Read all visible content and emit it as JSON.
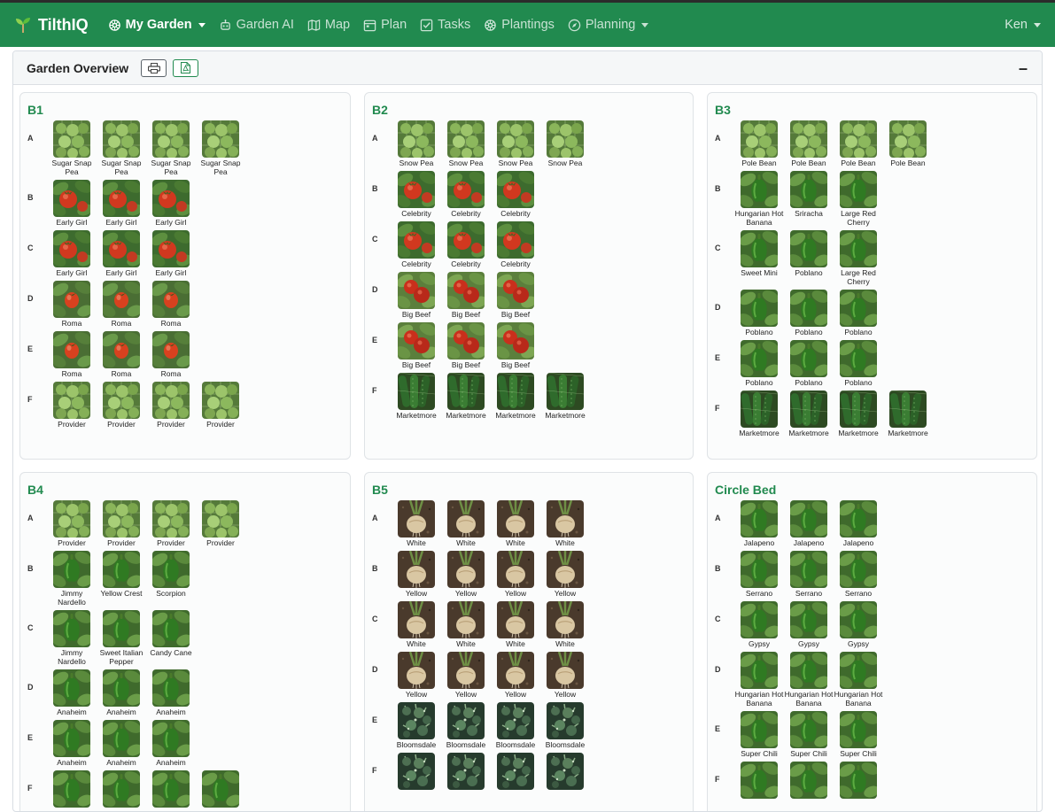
{
  "app": {
    "name": "TilthIQ"
  },
  "nav": {
    "items": [
      {
        "label": "My Garden",
        "icon": "flower-icon",
        "active": true,
        "dropdown": true
      },
      {
        "label": "Garden AI",
        "icon": "robot-icon",
        "active": false,
        "dropdown": false
      },
      {
        "label": "Map",
        "icon": "map-icon",
        "active": false,
        "dropdown": false
      },
      {
        "label": "Plan",
        "icon": "calendar-icon",
        "active": false,
        "dropdown": false
      },
      {
        "label": "Tasks",
        "icon": "checkbox-icon",
        "active": false,
        "dropdown": false
      },
      {
        "label": "Plantings",
        "icon": "flower-icon",
        "active": false,
        "dropdown": false
      },
      {
        "label": "Planning",
        "icon": "compass-icon",
        "active": false,
        "dropdown": true
      }
    ],
    "user": "Ken"
  },
  "overview": {
    "title": "Garden Overview",
    "collapse_label": "–"
  },
  "colors": {
    "brand": "#218a4f",
    "accent": "#218a4f"
  },
  "beds": [
    {
      "name": "B1",
      "rows": [
        {
          "label": "A",
          "plants": [
            {
              "name": "Sugar Snap Pea",
              "type": "pea"
            },
            {
              "name": "Sugar Snap Pea",
              "type": "pea"
            },
            {
              "name": "Sugar Snap Pea",
              "type": "pea"
            },
            {
              "name": "Sugar Snap Pea",
              "type": "pea"
            }
          ]
        },
        {
          "label": "B",
          "plants": [
            {
              "name": "Early Girl",
              "type": "tomato"
            },
            {
              "name": "Early Girl",
              "type": "tomato"
            },
            {
              "name": "Early Girl",
              "type": "tomato"
            }
          ]
        },
        {
          "label": "C",
          "plants": [
            {
              "name": "Early Girl",
              "type": "tomato"
            },
            {
              "name": "Early Girl",
              "type": "tomato"
            },
            {
              "name": "Early Girl",
              "type": "tomato"
            }
          ]
        },
        {
          "label": "D",
          "plants": [
            {
              "name": "Roma",
              "type": "roma"
            },
            {
              "name": "Roma",
              "type": "roma"
            },
            {
              "name": "Roma",
              "type": "roma"
            }
          ]
        },
        {
          "label": "E",
          "plants": [
            {
              "name": "Roma",
              "type": "roma"
            },
            {
              "name": "Roma",
              "type": "roma"
            },
            {
              "name": "Roma",
              "type": "roma"
            }
          ]
        },
        {
          "label": "F",
          "plants": [
            {
              "name": "Provider",
              "type": "pea"
            },
            {
              "name": "Provider",
              "type": "pea"
            },
            {
              "name": "Provider",
              "type": "pea"
            },
            {
              "name": "Provider",
              "type": "pea"
            }
          ]
        }
      ]
    },
    {
      "name": "B2",
      "rows": [
        {
          "label": "A",
          "plants": [
            {
              "name": "Snow Pea",
              "type": "pea"
            },
            {
              "name": "Snow Pea",
              "type": "pea"
            },
            {
              "name": "Snow Pea",
              "type": "pea"
            },
            {
              "name": "Snow Pea",
              "type": "pea"
            }
          ]
        },
        {
          "label": "B",
          "plants": [
            {
              "name": "Celebrity",
              "type": "tomato"
            },
            {
              "name": "Celebrity",
              "type": "tomato"
            },
            {
              "name": "Celebrity",
              "type": "tomato"
            }
          ]
        },
        {
          "label": "C",
          "plants": [
            {
              "name": "Celebrity",
              "type": "tomato"
            },
            {
              "name": "Celebrity",
              "type": "tomato"
            },
            {
              "name": "Celebrity",
              "type": "tomato"
            }
          ]
        },
        {
          "label": "D",
          "plants": [
            {
              "name": "Big Beef",
              "type": "bigbeef"
            },
            {
              "name": "Big Beef",
              "type": "bigbeef"
            },
            {
              "name": "Big Beef",
              "type": "bigbeef"
            }
          ]
        },
        {
          "label": "E",
          "plants": [
            {
              "name": "Big Beef",
              "type": "bigbeef"
            },
            {
              "name": "Big Beef",
              "type": "bigbeef"
            },
            {
              "name": "Big Beef",
              "type": "bigbeef"
            }
          ]
        },
        {
          "label": "F",
          "plants": [
            {
              "name": "Marketmore",
              "type": "cucumber"
            },
            {
              "name": "Marketmore",
              "type": "cucumber"
            },
            {
              "name": "Marketmore",
              "type": "cucumber"
            },
            {
              "name": "Marketmore",
              "type": "cucumber"
            }
          ]
        }
      ]
    },
    {
      "name": "B3",
      "rows": [
        {
          "label": "A",
          "plants": [
            {
              "name": "Pole Bean",
              "type": "pea"
            },
            {
              "name": "Pole Bean",
              "type": "pea"
            },
            {
              "name": "Pole Bean",
              "type": "pea"
            },
            {
              "name": "Pole Bean",
              "type": "pea"
            }
          ]
        },
        {
          "label": "B",
          "plants": [
            {
              "name": "Hungarian Hot Banana",
              "type": "pepper"
            },
            {
              "name": "Sriracha",
              "type": "pepper"
            },
            {
              "name": "Large Red Cherry",
              "type": "pepper"
            }
          ]
        },
        {
          "label": "C",
          "plants": [
            {
              "name": "Sweet Mini",
              "type": "pepper"
            },
            {
              "name": "Poblano",
              "type": "pepper"
            },
            {
              "name": "Large Red Cherry",
              "type": "pepper"
            }
          ]
        },
        {
          "label": "D",
          "plants": [
            {
              "name": "Poblano",
              "type": "pepper"
            },
            {
              "name": "Poblano",
              "type": "pepper"
            },
            {
              "name": "Poblano",
              "type": "pepper"
            }
          ]
        },
        {
          "label": "E",
          "plants": [
            {
              "name": "Poblano",
              "type": "pepper"
            },
            {
              "name": "Poblano",
              "type": "pepper"
            },
            {
              "name": "Poblano",
              "type": "pepper"
            }
          ]
        },
        {
          "label": "F",
          "plants": [
            {
              "name": "Marketmore",
              "type": "cucumber"
            },
            {
              "name": "Marketmore",
              "type": "cucumber"
            },
            {
              "name": "Marketmore",
              "type": "cucumber"
            },
            {
              "name": "Marketmore",
              "type": "cucumber"
            }
          ]
        }
      ]
    },
    {
      "name": "B4",
      "rows": [
        {
          "label": "A",
          "plants": [
            {
              "name": "Provider",
              "type": "pea"
            },
            {
              "name": "Provider",
              "type": "pea"
            },
            {
              "name": "Provider",
              "type": "pea"
            },
            {
              "name": "Provider",
              "type": "pea"
            }
          ]
        },
        {
          "label": "B",
          "plants": [
            {
              "name": "Jimmy Nardello",
              "type": "pepper"
            },
            {
              "name": "Yellow Crest",
              "type": "pepper"
            },
            {
              "name": "Scorpion",
              "type": "pepper"
            }
          ]
        },
        {
          "label": "C",
          "plants": [
            {
              "name": "Jimmy Nardello",
              "type": "pepper"
            },
            {
              "name": "Sweet Italian Pepper",
              "type": "pepper"
            },
            {
              "name": "Candy Cane",
              "type": "pepper"
            }
          ]
        },
        {
          "label": "D",
          "plants": [
            {
              "name": "Anaheim",
              "type": "pepper"
            },
            {
              "name": "Anaheim",
              "type": "pepper"
            },
            {
              "name": "Anaheim",
              "type": "pepper"
            }
          ]
        },
        {
          "label": "E",
          "plants": [
            {
              "name": "Anaheim",
              "type": "pepper"
            },
            {
              "name": "Anaheim",
              "type": "pepper"
            },
            {
              "name": "Anaheim",
              "type": "pepper"
            }
          ]
        },
        {
          "label": "F",
          "plants": [
            {
              "name": "",
              "type": "pepper"
            },
            {
              "name": "",
              "type": "pepper"
            },
            {
              "name": "",
              "type": "pepper"
            },
            {
              "name": "",
              "type": "pepper"
            }
          ]
        }
      ]
    },
    {
      "name": "B5",
      "rows": [
        {
          "label": "A",
          "plants": [
            {
              "name": "White",
              "type": "onion"
            },
            {
              "name": "White",
              "type": "onion"
            },
            {
              "name": "White",
              "type": "onion"
            },
            {
              "name": "White",
              "type": "onion"
            }
          ]
        },
        {
          "label": "B",
          "plants": [
            {
              "name": "Yellow",
              "type": "onion"
            },
            {
              "name": "Yellow",
              "type": "onion"
            },
            {
              "name": "Yellow",
              "type": "onion"
            },
            {
              "name": "Yellow",
              "type": "onion"
            }
          ]
        },
        {
          "label": "C",
          "plants": [
            {
              "name": "White",
              "type": "onion"
            },
            {
              "name": "White",
              "type": "onion"
            },
            {
              "name": "White",
              "type": "onion"
            },
            {
              "name": "White",
              "type": "onion"
            }
          ]
        },
        {
          "label": "D",
          "plants": [
            {
              "name": "Yellow",
              "type": "onion"
            },
            {
              "name": "Yellow",
              "type": "onion"
            },
            {
              "name": "Yellow",
              "type": "onion"
            },
            {
              "name": "Yellow",
              "type": "onion"
            }
          ]
        },
        {
          "label": "E",
          "plants": [
            {
              "name": "Bloomsdale",
              "type": "spinach"
            },
            {
              "name": "Bloomsdale",
              "type": "spinach"
            },
            {
              "name": "Bloomsdale",
              "type": "spinach"
            },
            {
              "name": "Bloomsdale",
              "type": "spinach"
            }
          ]
        },
        {
          "label": "F",
          "plants": [
            {
              "name": "",
              "type": "spinach"
            },
            {
              "name": "",
              "type": "spinach"
            },
            {
              "name": "",
              "type": "spinach"
            },
            {
              "name": "",
              "type": "spinach"
            }
          ]
        }
      ]
    },
    {
      "name": "Circle Bed",
      "rows": [
        {
          "label": "A",
          "plants": [
            {
              "name": "Jalapeno",
              "type": "pepper"
            },
            {
              "name": "Jalapeno",
              "type": "pepper"
            },
            {
              "name": "Jalapeno",
              "type": "pepper"
            }
          ]
        },
        {
          "label": "B",
          "plants": [
            {
              "name": "Serrano",
              "type": "pepper"
            },
            {
              "name": "Serrano",
              "type": "pepper"
            },
            {
              "name": "Serrano",
              "type": "pepper"
            }
          ]
        },
        {
          "label": "C",
          "plants": [
            {
              "name": "Gypsy",
              "type": "pepper"
            },
            {
              "name": "Gypsy",
              "type": "pepper"
            },
            {
              "name": "Gypsy",
              "type": "pepper"
            }
          ]
        },
        {
          "label": "D",
          "plants": [
            {
              "name": "Hungarian Hot Banana",
              "type": "pepper"
            },
            {
              "name": "Hungarian Hot Banana",
              "type": "pepper"
            },
            {
              "name": "Hungarian Hot Banana",
              "type": "pepper"
            }
          ]
        },
        {
          "label": "E",
          "plants": [
            {
              "name": "Super Chili",
              "type": "pepper"
            },
            {
              "name": "Super Chili",
              "type": "pepper"
            },
            {
              "name": "Super Chili",
              "type": "pepper"
            }
          ]
        },
        {
          "label": "F",
          "plants": [
            {
              "name": "",
              "type": "pepper"
            },
            {
              "name": "",
              "type": "pepper"
            },
            {
              "name": "",
              "type": "pepper"
            }
          ]
        }
      ]
    }
  ]
}
